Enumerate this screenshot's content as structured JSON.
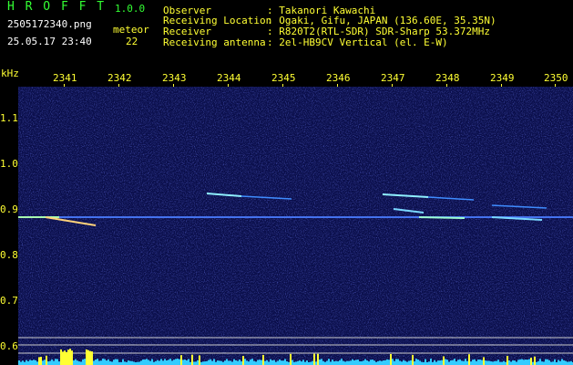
{
  "header": {
    "app_title": "H R O F F T",
    "version": "1.0.0",
    "filename": "2505172340.png",
    "datetime": "25.05.17 23:40",
    "meteor_label": "meteor",
    "meteor_count": "22",
    "info_labels": [
      "Observer",
      "Receiving Location",
      "Receiver",
      "Receiving antenna"
    ],
    "info_values": [
      ": Takanori Kawachi",
      ": Ogaki, Gifu, JAPAN (136.60E, 35.35N)",
      ": R820T2(RTL-SDR) SDR-Sharp 53.372MHz",
      ": 2el-HB9CV Vertical (el. E-W)"
    ]
  },
  "axis": {
    "unit": "kHz",
    "time_ticks": [
      "2341",
      "2342",
      "2343",
      "2344",
      "2345",
      "2346",
      "2347",
      "2348",
      "2349",
      "2350"
    ],
    "freq_ticks": [
      "1.1",
      "1.0",
      "0.9",
      "0.8",
      "0.7",
      "0.6"
    ]
  },
  "colors": {
    "background": "#000000",
    "spectrogram_bg": "#0a0e4a",
    "accent_green": "#33ff33",
    "accent_yellow": "#ffff33",
    "signal_cyan": "#6fe8ff",
    "level_bar": "#33ccff"
  }
}
